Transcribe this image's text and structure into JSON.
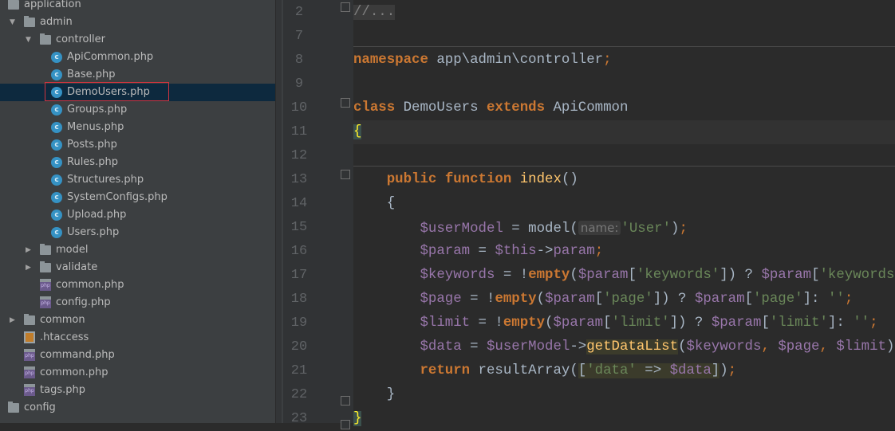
{
  "tree": [
    {
      "label": "application",
      "level": 0,
      "type": "folder",
      "arrow": ""
    },
    {
      "label": "admin",
      "level": 1,
      "type": "folder",
      "arrow": "▼"
    },
    {
      "label": "controller",
      "level": 2,
      "type": "folder",
      "arrow": "▼"
    },
    {
      "label": "ApiCommon.php",
      "level": 3,
      "type": "class"
    },
    {
      "label": "Base.php",
      "level": 3,
      "type": "class"
    },
    {
      "label": "DemoUsers.php",
      "level": 3,
      "type": "class",
      "selected": true
    },
    {
      "label": "Groups.php",
      "level": 3,
      "type": "class"
    },
    {
      "label": "Menus.php",
      "level": 3,
      "type": "class"
    },
    {
      "label": "Posts.php",
      "level": 3,
      "type": "class"
    },
    {
      "label": "Rules.php",
      "level": 3,
      "type": "class"
    },
    {
      "label": "Structures.php",
      "level": 3,
      "type": "class"
    },
    {
      "label": "SystemConfigs.php",
      "level": 3,
      "type": "class"
    },
    {
      "label": "Upload.php",
      "level": 3,
      "type": "class"
    },
    {
      "label": "Users.php",
      "level": 3,
      "type": "class"
    },
    {
      "label": "model",
      "level": 2,
      "type": "folder",
      "arrow": "▶"
    },
    {
      "label": "validate",
      "level": 2,
      "type": "folder",
      "arrow": "▶"
    },
    {
      "label": "common.php",
      "level": 2,
      "type": "php"
    },
    {
      "label": "config.php",
      "level": 2,
      "type": "php"
    },
    {
      "label": "common",
      "level": 1,
      "type": "folder",
      "arrow": "▶"
    },
    {
      "label": ".htaccess",
      "level": 1,
      "type": "htaccess"
    },
    {
      "label": "command.php",
      "level": 1,
      "type": "php"
    },
    {
      "label": "common.php",
      "level": 1,
      "type": "php"
    },
    {
      "label": "tags.php",
      "level": 1,
      "type": "php"
    },
    {
      "label": "config",
      "level": 0,
      "type": "folder",
      "arrow": ""
    }
  ],
  "code": [
    {
      "num": "2",
      "tokens": [
        {
          "t": "//...",
          "c": "cm"
        }
      ]
    },
    {
      "num": "7",
      "tokens": []
    },
    {
      "num": "8",
      "tokens": [
        {
          "t": "namespace",
          "c": "k"
        },
        {
          "t": " app\\admin\\controller",
          "c": ""
        },
        {
          "t": ";",
          "c": "kn"
        }
      ]
    },
    {
      "num": "9",
      "tokens": []
    },
    {
      "num": "10",
      "tokens": [
        {
          "t": "class",
          "c": "k"
        },
        {
          "t": " DemoUsers ",
          "c": ""
        },
        {
          "t": "extends",
          "c": "k"
        },
        {
          "t": " ApiCommon",
          "c": ""
        }
      ]
    },
    {
      "num": "11",
      "tokens": [
        {
          "t": "{",
          "c": "brace"
        }
      ],
      "current": true
    },
    {
      "num": "12",
      "tokens": []
    },
    {
      "num": "13",
      "tokens": [
        {
          "t": "    ",
          "c": ""
        },
        {
          "t": "public",
          "c": "k"
        },
        {
          "t": " ",
          "c": ""
        },
        {
          "t": "function",
          "c": "k"
        },
        {
          "t": " ",
          "c": ""
        },
        {
          "t": "index",
          "c": "f"
        },
        {
          "t": "()",
          "c": ""
        }
      ]
    },
    {
      "num": "14",
      "tokens": [
        {
          "t": "    {",
          "c": ""
        }
      ]
    },
    {
      "num": "15",
      "tokens": [
        {
          "t": "        ",
          "c": ""
        },
        {
          "t": "$userModel",
          "c": "v"
        },
        {
          "t": " = model(",
          "c": ""
        },
        {
          "t": "name:",
          "c": "hint"
        },
        {
          "t": "'User'",
          "c": "s"
        },
        {
          "t": ")",
          "c": ""
        },
        {
          "t": ";",
          "c": "kn"
        }
      ]
    },
    {
      "num": "16",
      "tokens": [
        {
          "t": "        ",
          "c": ""
        },
        {
          "t": "$param",
          "c": "v"
        },
        {
          "t": " = ",
          "c": ""
        },
        {
          "t": "$this",
          "c": "v"
        },
        {
          "t": "->",
          "c": ""
        },
        {
          "t": "param",
          "c": "v"
        },
        {
          "t": ";",
          "c": "kn"
        }
      ]
    },
    {
      "num": "17",
      "tokens": [
        {
          "t": "        ",
          "c": ""
        },
        {
          "t": "$keywords",
          "c": "v"
        },
        {
          "t": " = !",
          "c": ""
        },
        {
          "t": "empty",
          "c": "k"
        },
        {
          "t": "(",
          "c": ""
        },
        {
          "t": "$param",
          "c": "v"
        },
        {
          "t": "[",
          "c": ""
        },
        {
          "t": "'keywords'",
          "c": "s"
        },
        {
          "t": "]) ? ",
          "c": ""
        },
        {
          "t": "$param",
          "c": "v"
        },
        {
          "t": "[",
          "c": ""
        },
        {
          "t": "'keywords'",
          "c": "s"
        },
        {
          "t": "]:",
          "c": ""
        }
      ]
    },
    {
      "num": "18",
      "tokens": [
        {
          "t": "        ",
          "c": ""
        },
        {
          "t": "$page",
          "c": "v"
        },
        {
          "t": " = !",
          "c": ""
        },
        {
          "t": "empty",
          "c": "k"
        },
        {
          "t": "(",
          "c": ""
        },
        {
          "t": "$param",
          "c": "v"
        },
        {
          "t": "[",
          "c": ""
        },
        {
          "t": "'page'",
          "c": "s"
        },
        {
          "t": "]) ? ",
          "c": ""
        },
        {
          "t": "$param",
          "c": "v"
        },
        {
          "t": "[",
          "c": ""
        },
        {
          "t": "'page'",
          "c": "s"
        },
        {
          "t": "]: ",
          "c": ""
        },
        {
          "t": "''",
          "c": "s"
        },
        {
          "t": ";",
          "c": "kn"
        }
      ]
    },
    {
      "num": "19",
      "tokens": [
        {
          "t": "        ",
          "c": ""
        },
        {
          "t": "$limit",
          "c": "v"
        },
        {
          "t": " = !",
          "c": ""
        },
        {
          "t": "empty",
          "c": "k"
        },
        {
          "t": "(",
          "c": ""
        },
        {
          "t": "$param",
          "c": "v"
        },
        {
          "t": "[",
          "c": ""
        },
        {
          "t": "'limit'",
          "c": "s"
        },
        {
          "t": "]) ? ",
          "c": ""
        },
        {
          "t": "$param",
          "c": "v"
        },
        {
          "t": "[",
          "c": ""
        },
        {
          "t": "'limit'",
          "c": "s"
        },
        {
          "t": "]: ",
          "c": ""
        },
        {
          "t": "''",
          "c": "s"
        },
        {
          "t": ";",
          "c": "kn"
        }
      ]
    },
    {
      "num": "20",
      "tokens": [
        {
          "t": "        ",
          "c": ""
        },
        {
          "t": "$data",
          "c": "v"
        },
        {
          "t": " = ",
          "c": ""
        },
        {
          "t": "$userModel",
          "c": "v"
        },
        {
          "t": "->",
          "c": ""
        },
        {
          "t": "getDataList",
          "c": "hlf"
        },
        {
          "t": "(",
          "c": ""
        },
        {
          "t": "$keywords",
          "c": "v"
        },
        {
          "t": ", ",
          "c": "kn"
        },
        {
          "t": "$page",
          "c": "v"
        },
        {
          "t": ", ",
          "c": "kn"
        },
        {
          "t": "$limit",
          "c": "v"
        },
        {
          "t": ")",
          "c": ""
        },
        {
          "t": ";",
          "c": "kn"
        }
      ]
    },
    {
      "num": "21",
      "tokens": [
        {
          "t": "        ",
          "c": ""
        },
        {
          "t": "return",
          "c": "k"
        },
        {
          "t": " resultArray(",
          "c": ""
        },
        {
          "t": "[",
          "c": "hl"
        },
        {
          "t": "'data'",
          "c": "s hl"
        },
        {
          "t": " => ",
          "c": "hl"
        },
        {
          "t": "$data",
          "c": "v hl"
        },
        {
          "t": "]",
          "c": "hl"
        },
        {
          "t": ")",
          "c": ""
        },
        {
          "t": ";",
          "c": "kn"
        }
      ]
    },
    {
      "num": "22",
      "tokens": [
        {
          "t": "    }",
          "c": ""
        }
      ]
    },
    {
      "num": "23",
      "tokens": [
        {
          "t": "}",
          "c": "brace"
        }
      ]
    }
  ]
}
